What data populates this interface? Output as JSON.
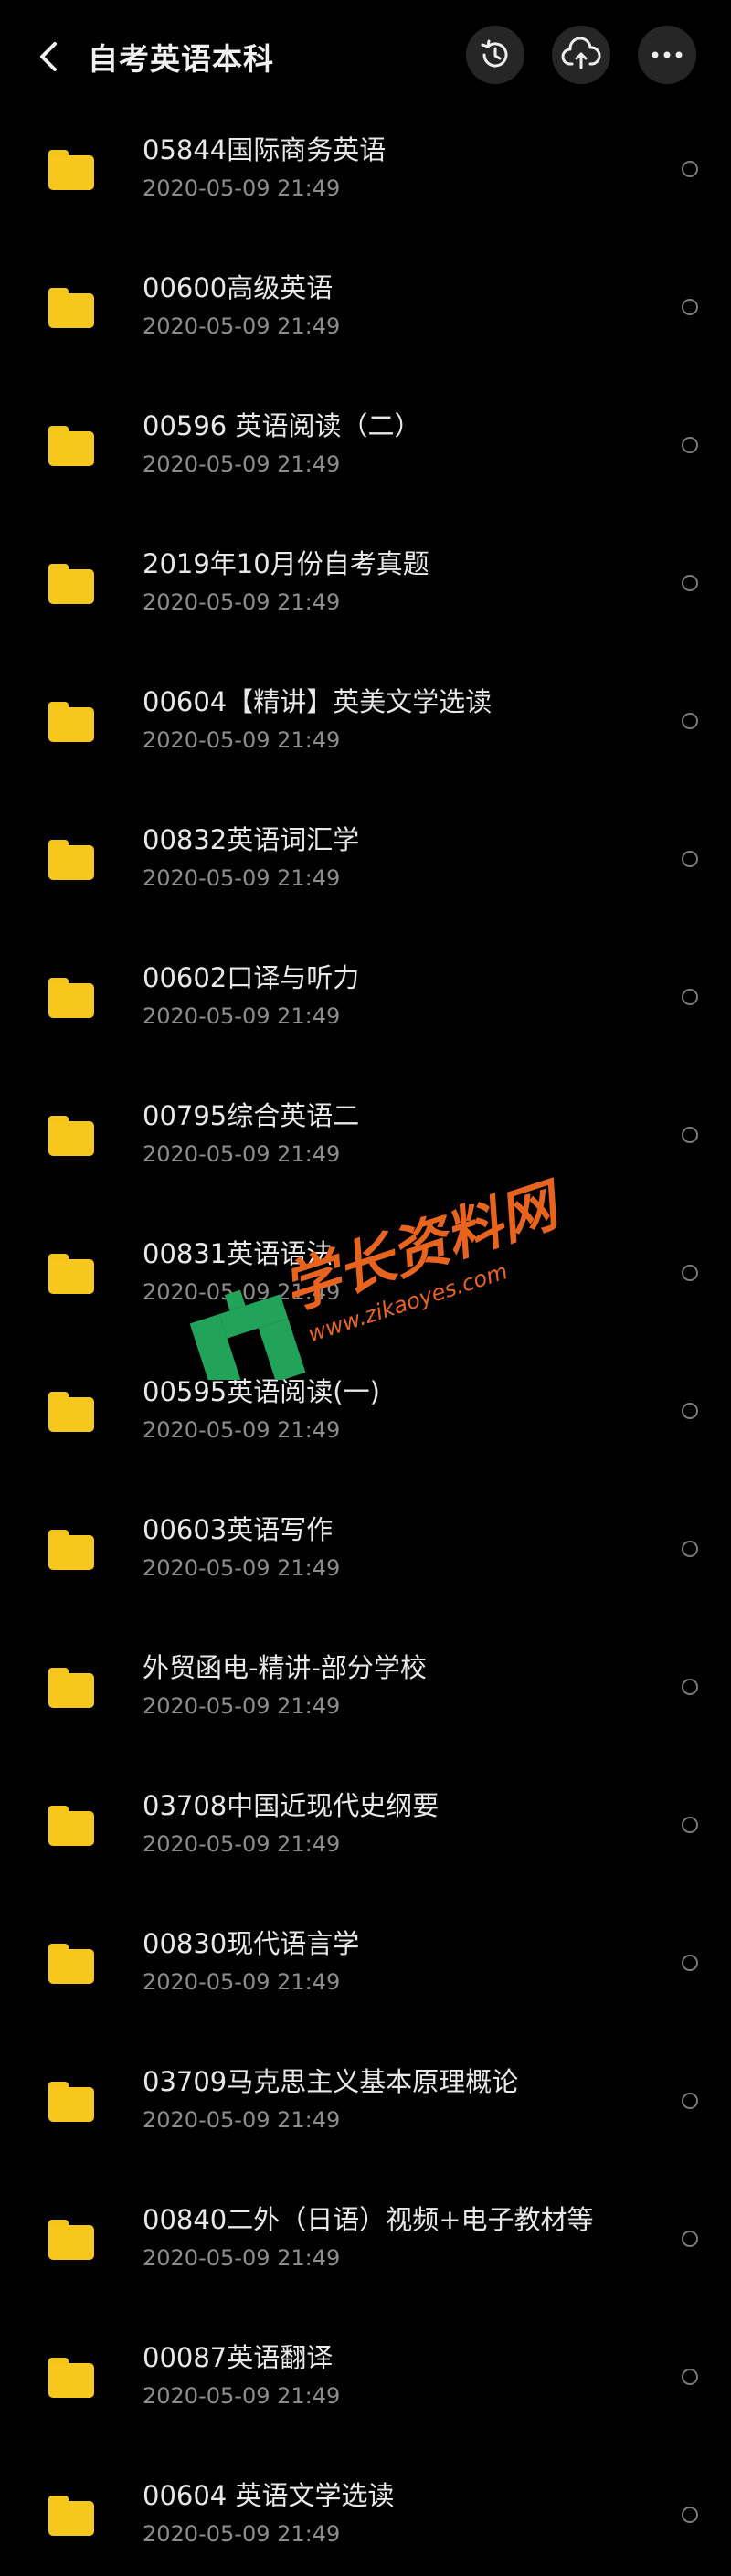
{
  "header": {
    "title": "自考英语本科",
    "back_icon": "chevron-left-icon",
    "history_icon": "history-icon",
    "cloud_icon": "cloud-upload-icon",
    "more_icon": "more-horizontal-icon"
  },
  "files": [
    {
      "name": "05844国际商务英语",
      "date": "2020-05-09  21:49"
    },
    {
      "name": "00600高级英语",
      "date": "2020-05-09  21:49"
    },
    {
      "name": "00596 英语阅读（二）",
      "date": "2020-05-09  21:49"
    },
    {
      "name": "2019年10月份自考真题",
      "date": "2020-05-09  21:49"
    },
    {
      "name": "00604【精讲】英美文学选读",
      "date": "2020-05-09  21:49"
    },
    {
      "name": "00832英语词汇学",
      "date": "2020-05-09  21:49"
    },
    {
      "name": "00602口译与听力",
      "date": "2020-05-09  21:49"
    },
    {
      "name": "00795综合英语二",
      "date": "2020-05-09  21:49"
    },
    {
      "name": "00831英语语法",
      "date": "2020-05-09  21:49"
    },
    {
      "name": "00595英语阅读(一)",
      "date": "2020-05-09  21:49"
    },
    {
      "name": "00603英语写作",
      "date": "2020-05-09  21:49"
    },
    {
      "name": "外贸函电-精讲-部分学校",
      "date": "2020-05-09  21:49"
    },
    {
      "name": "03708中国近现代史纲要",
      "date": "2020-05-09  21:49"
    },
    {
      "name": "00830现代语言学",
      "date": "2020-05-09  21:49"
    },
    {
      "name": "03709马克思主义基本原理概论",
      "date": "2020-05-09  21:49"
    },
    {
      "name": "00840二外（日语）视频+电子教材等",
      "date": "2020-05-09  21:49"
    },
    {
      "name": "00087英语翻译",
      "date": "2020-05-09  21:49"
    },
    {
      "name": "00604 英语文学选读",
      "date": "2020-05-09  21:49"
    }
  ],
  "watermark": {
    "text": "学长资料网",
    "url": "www.zikaoyes.com"
  },
  "colors": {
    "background": "#000000",
    "folder": "#f7c81b",
    "text": "#e8e8e8",
    "subtext": "#8c8c8c",
    "watermark_orange": "#e8641e",
    "watermark_green": "#22a35a"
  }
}
